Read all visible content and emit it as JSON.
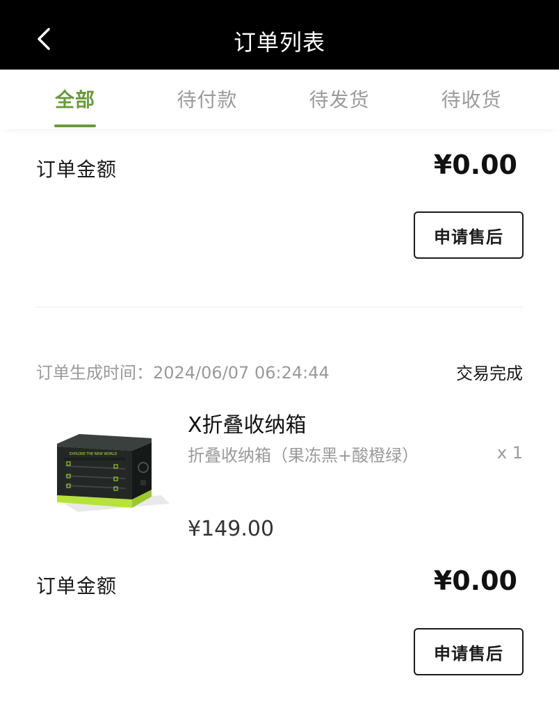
{
  "header": {
    "title": "订单列表",
    "back_icon": "chevron-left-icon"
  },
  "tabs": [
    {
      "label": "全部",
      "active": true
    },
    {
      "label": "待付款",
      "active": false
    },
    {
      "label": "待发货",
      "active": false
    },
    {
      "label": "待收货",
      "active": false
    }
  ],
  "orders": [
    {
      "amount_label": "订单金额",
      "amount": "¥0.00",
      "action_label": "申请售后"
    },
    {
      "time_label": "订单生成时间：",
      "time_value": "2024/06/07 06:24:44",
      "status": "交易完成",
      "product": {
        "name": "X折叠收纳箱",
        "spec": "折叠收纳箱（果冻黑+酸橙绿）",
        "qty": "x 1",
        "price": "¥149.00",
        "thumb_icon": "folding-storage-box-image"
      },
      "amount_label": "订单金额",
      "amount": "¥0.00",
      "action_label": "申请售后"
    }
  ],
  "colors": {
    "accent": "#6a9a3c",
    "header_bg": "#000000",
    "muted": "#9a9a9a",
    "box_accent": "#b6e23a"
  }
}
